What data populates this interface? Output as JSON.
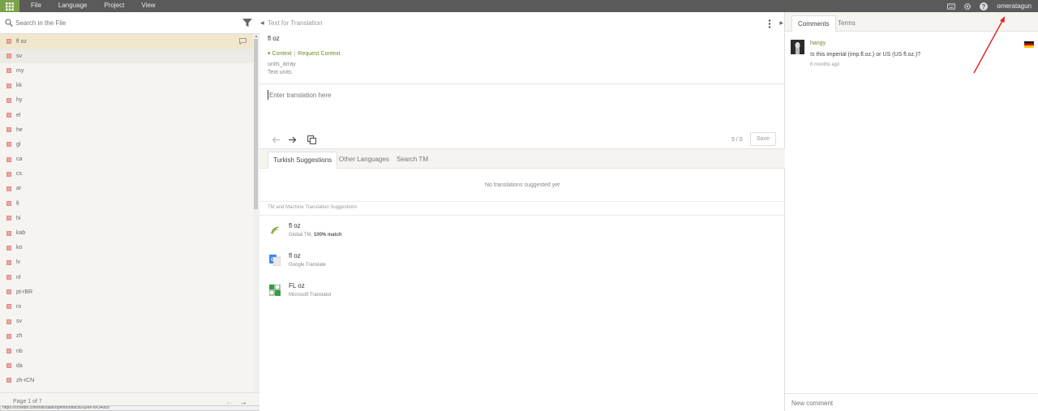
{
  "topbar": {
    "menu": [
      "File",
      "Language",
      "Project",
      "View"
    ],
    "user": "omeratagun",
    "icons": [
      "keyboard-icon",
      "gear-icon",
      "help-icon"
    ]
  },
  "left": {
    "search_placeholder": "Search in the File",
    "strings": [
      "fl oz",
      "sv",
      "my",
      "kk",
      "hy",
      "el",
      "he",
      "gl",
      "ca",
      "cs",
      "ar",
      "fi",
      "hi",
      "kab",
      "ko",
      "lv",
      "nl",
      "pt-rBR",
      "ro",
      "sv",
      "zh",
      "nb",
      "da",
      "zh-rCN"
    ],
    "active_index": 0,
    "pager": "Page 1 of 7",
    "status_url": "https://crowdin.com/translate/openfoodfacts/93/en-tr#34989"
  },
  "source": {
    "header": "Text for Translation",
    "text": "fl oz",
    "context_label": "Context",
    "request_context": "Request Context",
    "context_key": "units_array",
    "context_desc": "Text units"
  },
  "translation": {
    "placeholder": "Enter translation here",
    "counter": "5 / 0",
    "save": "Save"
  },
  "suggestions": {
    "tabs": [
      "Turkish Suggestions",
      "Other Languages",
      "Search TM"
    ],
    "empty": "No translations suggested yet",
    "tm_header": "TM and Machine Translation Suggestions",
    "items": [
      {
        "text": "fl oz",
        "source": "Global TM, ",
        "match": "100% match"
      },
      {
        "text": "fl oz",
        "source": "Google Translate",
        "match": ""
      },
      {
        "text": "FL oz",
        "source": "Microsoft Translator",
        "match": ""
      }
    ]
  },
  "comments": {
    "tabs": [
      "Comments",
      "Terms"
    ],
    "user": "hangy",
    "text": "Is this imperial (imp.fl.oz.) or US (US fl.oz.)?",
    "time": "6 months ago",
    "new_placeholder": "New comment"
  },
  "colors": {
    "topbar": "#5a5a5a",
    "accent_green": "#7aa24a",
    "active_row": "#f0e7cc",
    "annotation_arrow": "#e02020"
  }
}
